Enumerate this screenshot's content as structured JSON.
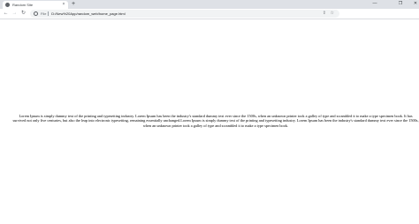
{
  "browser": {
    "tab_title": "Random Site",
    "tab_close": "×",
    "new_tab": "+",
    "window_controls": {
      "minimize": "—",
      "maximize": "❐",
      "close": "✕"
    },
    "nav": {
      "back": "←",
      "forward": "→",
      "reload": "↻"
    },
    "address": {
      "scheme_label": "File",
      "url": "D:/New%20App/random_web/home_page.html"
    },
    "icons": {
      "favicon": "globe-icon",
      "info": "info-icon",
      "share": "share-icon",
      "bookmark": "star-icon"
    },
    "share_glyph": "⇪",
    "star_glyph": "☆"
  },
  "page": {
    "paragraph": "Lorem Ipsum is simply dummy text of the printing and typesetting industry. Lorem Ipsum has been the industry's standard dummy text ever since the 1500s, when an unknown printer took a galley of type and scrambled it to make a type specimen book. It has survived not only five centuries, but also the leap into electronic typesetting, remaining essentially unchanged.Lorem Ipsum is simply dummy text of the printing and typesetting industry. Lorem Ipsum has been the industry's standard dummy text ever since the 1500s, when an unknown printer took a galley of type and scrambled it to make a type specimen book."
  },
  "colors": {
    "titlebar": "#dee1e6",
    "omnibox": "#f1f3f4",
    "text": "#000000"
  }
}
